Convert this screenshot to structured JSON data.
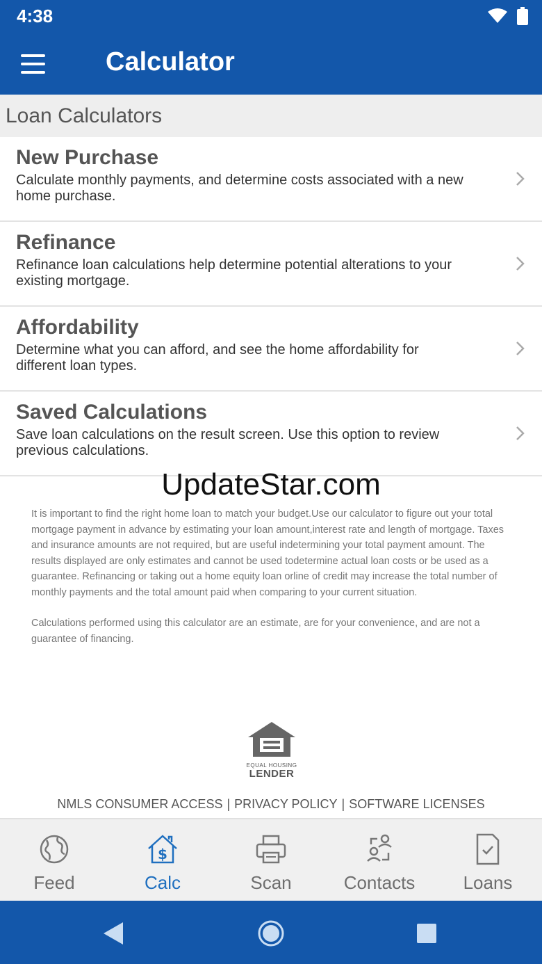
{
  "status": {
    "time": "4:38"
  },
  "appbar": {
    "title": "Calculator"
  },
  "section": {
    "header": "Loan Calculators"
  },
  "items": [
    {
      "title": "New Purchase",
      "desc": "Calculate monthly payments, and determine costs associated with a new home purchase."
    },
    {
      "title": "Refinance",
      "desc": "Refinance loan calculations help determine potential alterations to your existing mortgage."
    },
    {
      "title": "Affordability",
      "desc": "Determine what you can afford, and see the home affordability for different loan types."
    },
    {
      "title": "Saved Calculations",
      "desc": "Save loan calculations on the result screen. Use this option to review previous calculations."
    }
  ],
  "watermark": "UpdateStar.com",
  "disclaimer": {
    "p1": "It is important to find the right home loan to match your budget.Use our calculator to figure out your total mortgage payment in advance by estimating your loan amount,interest rate and length of mortgage. Taxes and insurance amounts are not required, but are useful indetermining your total payment amount. The results displayed are only estimates and cannot be used todetermine actual loan costs or be used as a guarantee. Refinancing or taking out a home equity loan orline of credit may increase the total number of monthly payments and the total amount paid when comparing to your current situation.",
    "p2": "Calculations performed using this calculator are an estimate, are for your convenience, and are not a guarantee of financing."
  },
  "logo": {
    "line1": "EQUAL HOUSING",
    "line2": "LENDER"
  },
  "links": {
    "nmls": "NMLS CONSUMER ACCESS",
    "privacy": "PRIVACY POLICY",
    "software": "SOFTWARE LICENSES",
    "separator": "|"
  },
  "tabs": [
    {
      "label": "Feed",
      "icon": "globe-icon"
    },
    {
      "label": "Calc",
      "icon": "house-dollar-icon",
      "active": true
    },
    {
      "label": "Scan",
      "icon": "printer-icon"
    },
    {
      "label": "Contacts",
      "icon": "contacts-icon"
    },
    {
      "label": "Loans",
      "icon": "document-check-icon"
    }
  ],
  "colors": {
    "primary": "#1357aa",
    "active_tab": "#1f6fbf",
    "tab_bg": "#f0f0f0",
    "section_bg": "#eeeeee"
  }
}
